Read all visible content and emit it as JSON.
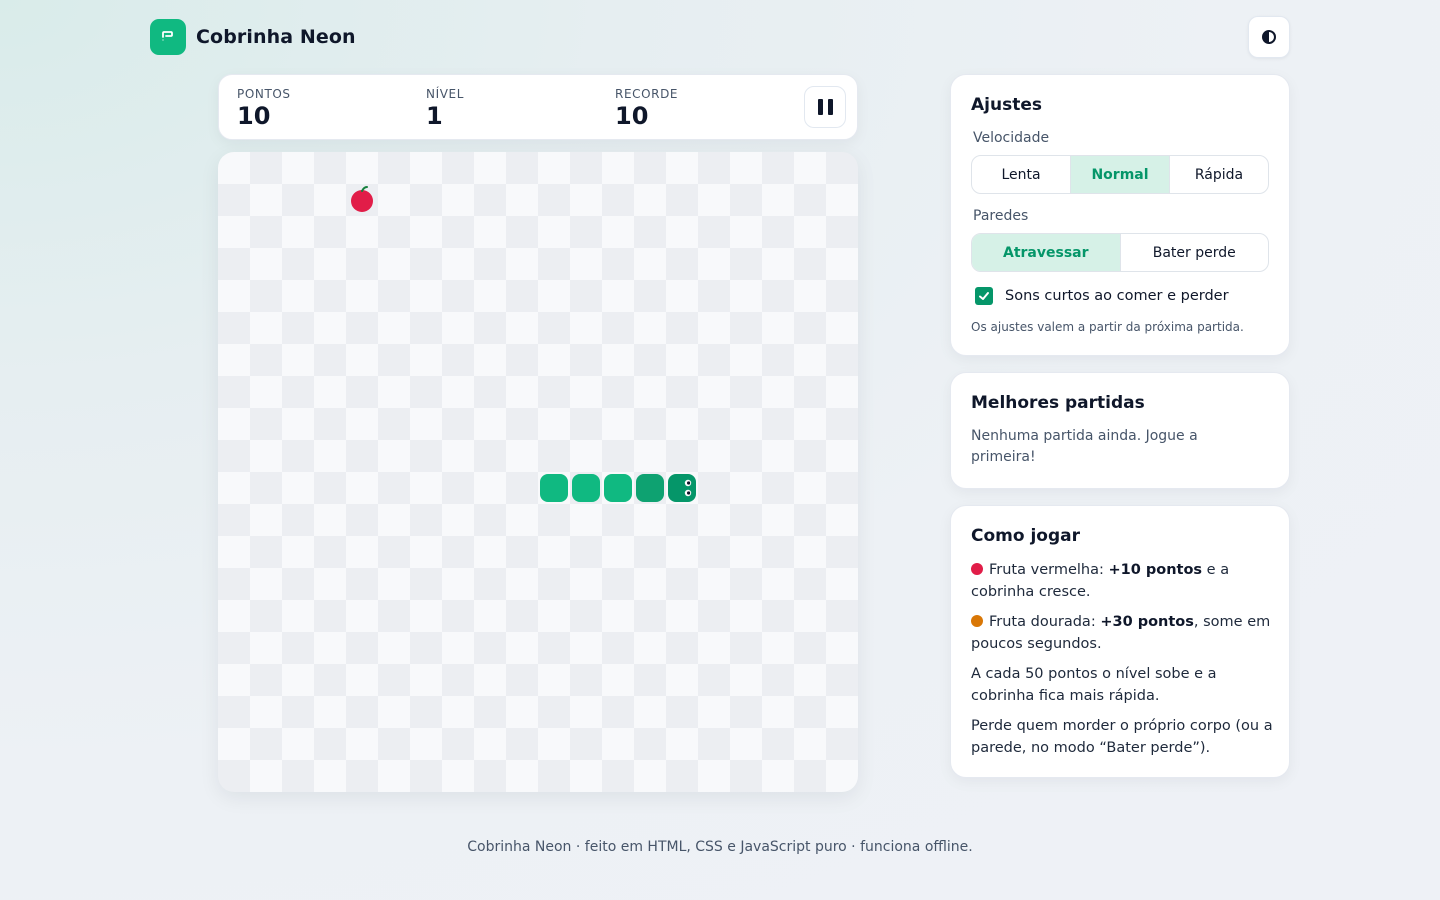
{
  "app": {
    "title": "Cobrinha Neon"
  },
  "header": {
    "theme_toggle_icon": "contrast-icon"
  },
  "scoreboard": {
    "points_label": "PONTOS",
    "points": "10",
    "level_label": "NÍVEL",
    "level": "1",
    "record_label": "RECORDE",
    "record": "10",
    "pause_icon": "pause-icon"
  },
  "game": {
    "grid_cols": 20,
    "grid_rows": 20,
    "fruit": {
      "type": "red",
      "col": 4,
      "row": 1,
      "color": "#e11d48"
    },
    "snake": [
      {
        "col": 14,
        "row": 10,
        "head": true
      },
      {
        "col": 13,
        "row": 10
      },
      {
        "col": 12,
        "row": 10
      },
      {
        "col": 11,
        "row": 10
      },
      {
        "col": 10,
        "row": 10
      }
    ],
    "snake_head_color": "#059669",
    "snake_body_color": "#10b981"
  },
  "settings": {
    "title": "Ajustes",
    "speed_label": "Velocidade",
    "speed_options": [
      "Lenta",
      "Normal",
      "Rápida"
    ],
    "speed_selected": "Normal",
    "walls_label": "Paredes",
    "walls_options": [
      "Atravessar",
      "Bater perde"
    ],
    "walls_selected": "Atravessar",
    "sound_label": "Sons curtos ao comer e perder",
    "sound_checked": true,
    "note": "Os ajustes valem a partir da próxima partida."
  },
  "best": {
    "title": "Melhores partidas",
    "empty_text": "Nenhuma partida ainda. Jogue a primeira!"
  },
  "howto": {
    "title": "Como jogar",
    "red_fruit": {
      "prefix": "Fruta vermelha: ",
      "bold": "+10 pontos",
      "suffix": " e a cobrinha cresce.",
      "color": "#e11d48"
    },
    "gold_fruit": {
      "prefix": "Fruta dourada: ",
      "bold": "+30 pontos",
      "suffix": ", some em poucos segundos.",
      "color": "#d97706"
    },
    "level_rule": "A cada 50 pontos o nível sobe e a cobrinha fica mais rápida.",
    "lose_rule": "Perde quem morder o próprio corpo (ou a parede, no modo “Bater perde”)."
  },
  "footer": {
    "text": "Cobrinha Neon · feito em HTML, CSS e JavaScript puro · funciona offline."
  },
  "colors": {
    "accent": "#10b981",
    "accent_dark": "#059669",
    "accent_light": "#d6f1e7"
  }
}
